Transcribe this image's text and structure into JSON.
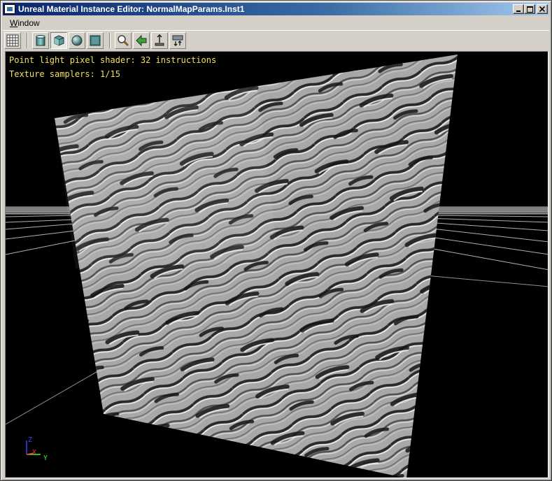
{
  "window": {
    "title": "Unreal Material Instance Editor: NormalMapParams.Inst1",
    "buttons": {
      "minimize": "_",
      "maximize": "□",
      "close": "✕"
    }
  },
  "menu": {
    "window_prefix": "W",
    "window_rest": "indow"
  },
  "toolbar": {
    "items": [
      {
        "icon": "grid-icon",
        "state": "raised"
      },
      {
        "icon": "cylinder-icon",
        "state": "raised"
      },
      {
        "icon": "cube-icon",
        "state": "pressed"
      },
      {
        "icon": "sphere-icon",
        "state": "raised"
      },
      {
        "icon": "plane-icon",
        "state": "raised"
      },
      {
        "icon": "magnifier-icon",
        "state": "raised"
      },
      {
        "icon": "back-arrow-icon",
        "state": "raised"
      },
      {
        "icon": "home-icon",
        "state": "raised"
      },
      {
        "icon": "refresh-icon",
        "state": "raised"
      }
    ]
  },
  "viewport": {
    "stats": {
      "line1": "Point light pixel shader: 32 instructions",
      "line2": "Texture samplers: 1/15"
    },
    "axes": {
      "z": "Z",
      "x": "X",
      "y": "Y"
    },
    "colors": {
      "background": "#000000",
      "stats_text": "#f0e060",
      "axis_z": "#4040ff",
      "axis_x": "#ff3030",
      "axis_y": "#30ff30",
      "grid": "#c0c0c0"
    }
  }
}
